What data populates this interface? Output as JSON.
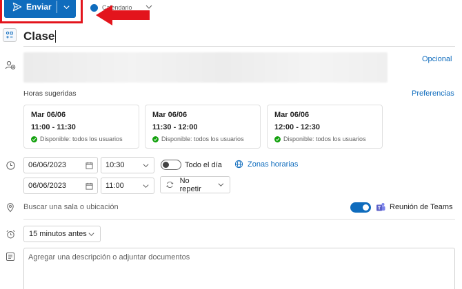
{
  "toolbar": {
    "send_label": "Enviar",
    "calendar_label": "Calendario",
    "calendar_color": "#0f6cbd"
  },
  "event": {
    "title": "Clase",
    "optional_label": "Opcional"
  },
  "suggested": {
    "label": "Horas sugeridas",
    "preferences_label": "Preferencias",
    "cards": [
      {
        "date": "Mar 06/06",
        "time": "11:00 - 11:30",
        "status": "Disponible: todos los usuarios"
      },
      {
        "date": "Mar 06/06",
        "time": "11:30 - 12:00",
        "status": "Disponible: todos los usuarios"
      },
      {
        "date": "Mar 06/06",
        "time": "12:00 - 12:30",
        "status": "Disponible: todos los usuarios"
      }
    ]
  },
  "schedule": {
    "start_date": "06/06/2023",
    "start_time": "10:30",
    "end_date": "06/06/2023",
    "end_time": "11:00",
    "all_day_label": "Todo el día",
    "time_zones_label": "Zonas horarias",
    "repeat_label": "No repetir"
  },
  "location": {
    "placeholder": "Buscar una sala o ubicación",
    "teams_label": "Reunión de Teams"
  },
  "reminder": {
    "value": "15 minutos antes"
  },
  "description": {
    "placeholder": "Agregar una descripción o adjuntar documentos"
  },
  "colors": {
    "accent": "#0f6cbd",
    "highlight": "#e3141c",
    "available": "#13a10e",
    "teams": "#5b5fc7"
  },
  "icons": [
    "send-icon",
    "chevron-down-icon",
    "title-template-icon",
    "people-icon",
    "clock-icon",
    "calendar-icon",
    "globe-icon",
    "repeat-icon",
    "location-icon",
    "teams-icon",
    "alarm-icon",
    "text-description-icon",
    "checkmark-icon"
  ]
}
